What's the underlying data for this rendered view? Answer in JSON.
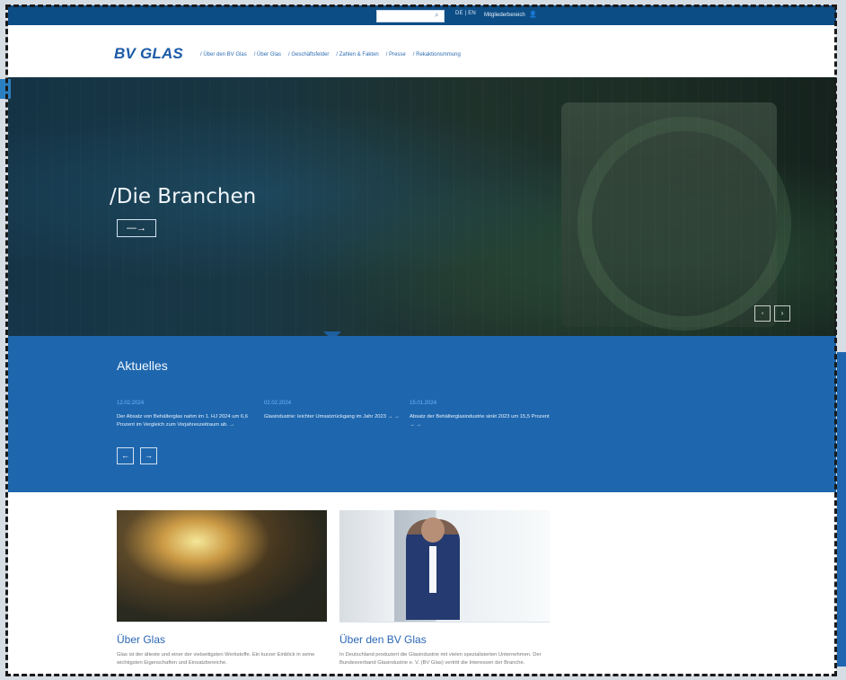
{
  "top": {
    "lang": "DE | EN",
    "member_label": "Mitgliederbereich",
    "search_placeholder": ""
  },
  "brand": {
    "logo": "BV GLAS"
  },
  "nav": [
    "/ Über den BV Glas",
    "/ Über Glas",
    "/ Geschäftsfelder",
    "/ Zahlen & Fakten",
    "/ Presse",
    "/ Rekaktionsmmung"
  ],
  "hero": {
    "title": "/Die Branchen",
    "button_label": "—→",
    "pager": [
      "◦",
      "›"
    ]
  },
  "news": {
    "title": "Aktuelles",
    "items": [
      {
        "date": "12.02.2024",
        "text": "Der Absatz von Behälterglas nahm im 1. HJ 2024 um 6,6 Prozent im Vergleich zum Vorjahreszeitraum ab. →"
      },
      {
        "date": "02.02.2024",
        "text": "Glasindustrie: leichter Umsatzrückgang im Jahr 2023 → →"
      },
      {
        "date": "15.01.2024",
        "text": "Absatz der Behälterglasindustrie sinkt 2023 um 15,5 Prozent → →"
      }
    ],
    "prev": "←",
    "next": "→"
  },
  "cards": [
    {
      "title": "Über Glas",
      "text": "Glas ist der älteste und einer der vielseitigsten Werkstoffe. Ein kurzer Einblick in seine wichtigsten Eigenschaften und Einsatzbereiche."
    },
    {
      "title": "Über den BV Glas",
      "text": "In Deutschland produziert die Glasindustrie mit vielen spezialisierten Unternehmen. Der Bundesverband Glasindustrie e. V. (BV Glas) vertritt die Interessen der Branche."
    }
  ]
}
